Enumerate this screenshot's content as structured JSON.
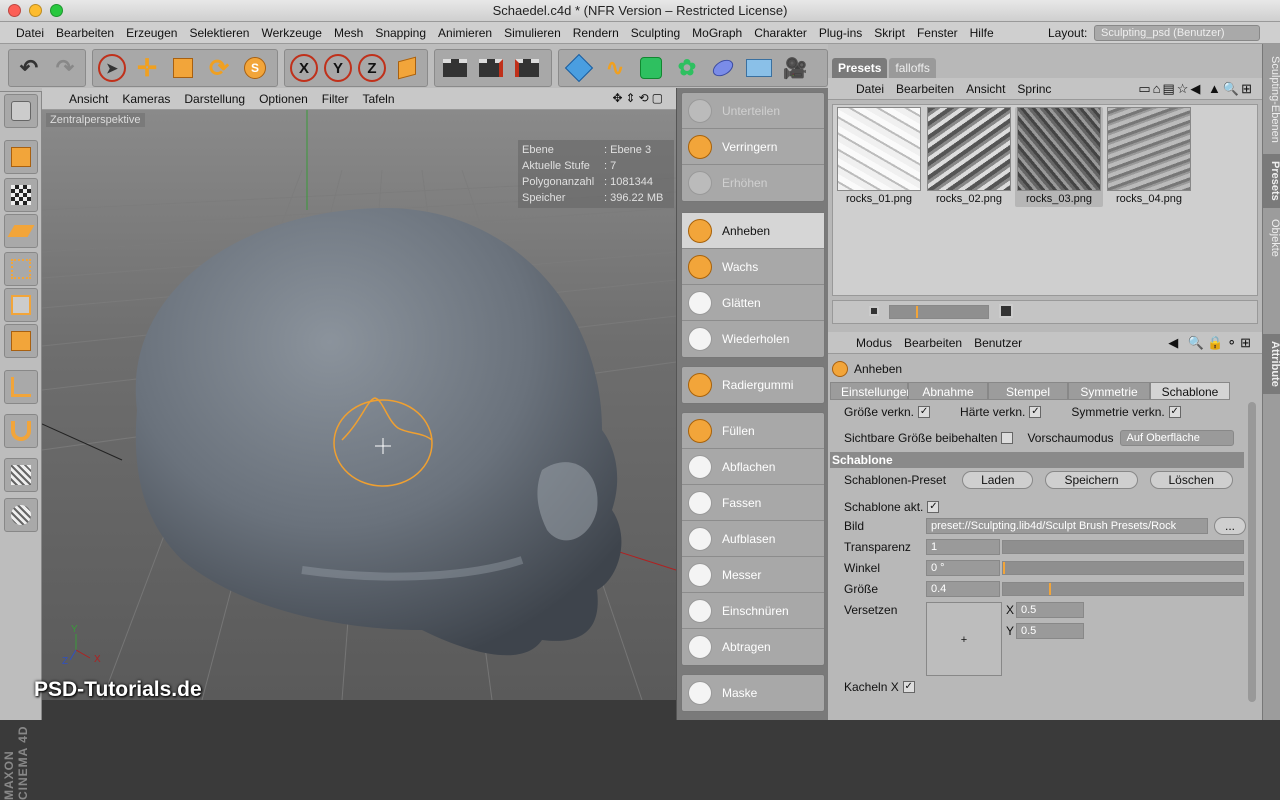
{
  "window": {
    "title": "Schaedel.c4d * (NFR Version – Restricted License)"
  },
  "menubar": {
    "items": [
      "Datei",
      "Bearbeiten",
      "Erzeugen",
      "Selektieren",
      "Werkzeuge",
      "Mesh",
      "Snapping",
      "Animieren",
      "Simulieren",
      "Rendern",
      "Sculpting",
      "MoGraph",
      "Charakter",
      "Plug-ins",
      "Skript",
      "Fenster",
      "Hilfe"
    ],
    "layout_label": "Layout:",
    "layout_value": "Sculpting_psd (Benutzer)"
  },
  "toolbar": {
    "axis_x": "X",
    "axis_y": "Y",
    "axis_z": "Z"
  },
  "viewport": {
    "menu": [
      "Ansicht",
      "Kameras",
      "Darstellung",
      "Optionen",
      "Filter",
      "Tafeln"
    ],
    "camera_label": "Zentralperspektive",
    "hud": [
      {
        "key": "Ebene",
        "value": ": Ebene 3"
      },
      {
        "key": "Aktuelle Stufe",
        "value": ": 7"
      },
      {
        "key": "Polygonanzahl",
        "value": ": 1081344"
      },
      {
        "key": "Speicher",
        "value": ": 396.22 MB"
      }
    ],
    "axis_labels": {
      "y": "Y",
      "x": "X",
      "z": "Z"
    }
  },
  "watermark": "PSD-Tutorials.de",
  "brand": "MAXON CINEMA 4D",
  "brushes": {
    "group1": [
      {
        "label": "Unterteilen",
        "dim": true
      },
      {
        "label": "Verringern",
        "dim": false
      },
      {
        "label": "Erhöhen",
        "dim": true
      }
    ],
    "group2": [
      {
        "label": "Anheben",
        "active": true
      },
      {
        "label": "Wachs"
      },
      {
        "label": "Glätten"
      },
      {
        "label": "Wiederholen"
      }
    ],
    "group3": [
      {
        "label": "Radiergummi"
      }
    ],
    "group4": [
      {
        "label": "Füllen"
      },
      {
        "label": "Abflachen"
      },
      {
        "label": "Fassen"
      },
      {
        "label": "Aufblasen"
      },
      {
        "label": "Messer"
      },
      {
        "label": "Einschnüren"
      },
      {
        "label": "Abtragen"
      }
    ],
    "group5": [
      {
        "label": "Maske"
      }
    ]
  },
  "presets": {
    "tabs": [
      "Presets",
      "falloffs"
    ],
    "menu": [
      "Datei",
      "Bearbeiten",
      "Ansicht",
      "Sprinc"
    ],
    "thumbs": [
      "rocks_01.png",
      "rocks_02.png",
      "rocks_03.png",
      "rocks_04.png"
    ]
  },
  "side_tabs": [
    "Sculpting-Ebenen",
    "Presets",
    "Objekte",
    "Attribute"
  ],
  "attributes": {
    "menu": [
      "Modus",
      "Bearbeiten",
      "Benutzer"
    ],
    "title": "Anheben",
    "tabs": [
      "Einstellungen",
      "Abnahme",
      "Stempel",
      "Symmetrie",
      "Schablone"
    ],
    "row1": {
      "a": "Größe verkn.",
      "b": "Härte verkn.",
      "c": "Symmetrie verkn."
    },
    "row2": {
      "a": "Sichtbare Größe beibehalten",
      "b": "Vorschaumodus",
      "c": "Auf Oberfläche"
    },
    "section": "Schablone",
    "preset_label": "Schablonen-Preset",
    "buttons": [
      "Laden",
      "Speichern",
      "Löschen"
    ],
    "schablone_akt": "Schablone akt.",
    "bild_label": "Bild",
    "bild_value": "preset://Sculpting.lib4d/Sculpt Brush Presets/Rock",
    "bild_btn": "...",
    "transparenz_label": "Transparenz",
    "transparenz_value": "1",
    "winkel_label": "Winkel",
    "winkel_value": "0 °",
    "groesse_label": "Größe",
    "groesse_value": "0.4",
    "versetzen_label": "Versetzen",
    "x_label": "X",
    "x_value": "0.5",
    "y_label": "Y",
    "y_value": "0.5",
    "kacheln_label": "Kacheln X"
  },
  "colors": {
    "accent": "#f2a53a",
    "skull": "#6e7680",
    "brush_circle": "#f0a030"
  }
}
